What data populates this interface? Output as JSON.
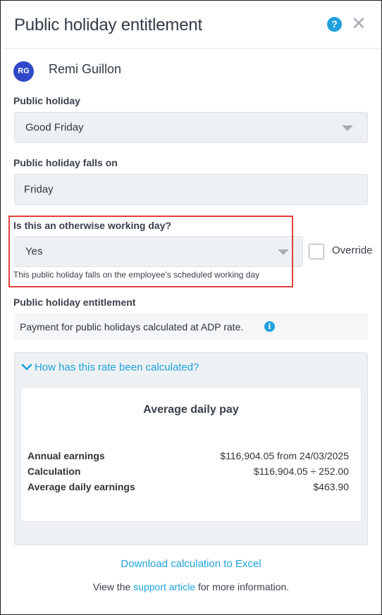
{
  "header": {
    "title": "Public holiday entitlement",
    "help_icon": "?",
    "close_icon": "✕"
  },
  "employee": {
    "initials": "RG",
    "name": "Remi Guillon"
  },
  "public_holiday": {
    "label": "Public holiday",
    "selected": "Good Friday"
  },
  "falls_on": {
    "label": "Public holiday falls on",
    "value": "Friday"
  },
  "working_day": {
    "label": "Is this an otherwise working day?",
    "selected": "Yes",
    "override_label": "Override",
    "override_checked": false,
    "hint": "This public holiday falls on the employee's scheduled working day"
  },
  "entitlement": {
    "label": "Public holiday entitlement",
    "info_text": "Payment for public holidays calculated at ADP rate.",
    "info_icon": "i"
  },
  "calculation": {
    "toggle_label": "How has this rate been calculated?",
    "title": "Average daily pay",
    "rows": [
      {
        "key": "Annual earnings",
        "value": "$116,904.05 from 24/03/2025"
      },
      {
        "key": "Calculation",
        "value": "$116,904.05 ÷ 252.00"
      },
      {
        "key": "Average daily earnings",
        "value": "$463.90"
      }
    ]
  },
  "download_link": "Download calculation to Excel",
  "footer": {
    "prefix": "View the ",
    "link": "support article",
    "suffix": " for more information."
  },
  "colors": {
    "accent": "#1ea1dc",
    "avatar": "#2f48c8",
    "highlight": "#e0413f"
  },
  "icons": [
    "help-icon",
    "close-icon",
    "chevron-down-icon",
    "info-icon",
    "dropdown-caret-icon"
  ]
}
